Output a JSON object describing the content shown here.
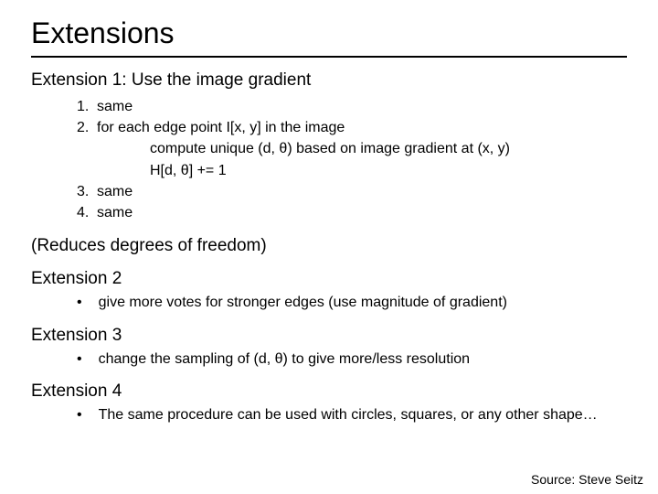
{
  "title": "Extensions",
  "ext1": {
    "heading": "Extension 1:  Use the image gradient",
    "items": {
      "n1": "1.",
      "t1": "same",
      "n2": "2.",
      "t2": "for each edge point I[x, y] in the image",
      "t2a": "compute unique (d, θ) based on image gradient at (x, y)",
      "t2b": "H[d, θ] += 1",
      "n3": "3.",
      "t3": "same",
      "n4": "4.",
      "t4": "same"
    }
  },
  "reduces": "(Reduces degrees of freedom)",
  "ext2": {
    "heading": "Extension 2",
    "bullet": "give more votes for stronger edges (use magnitude of gradient)"
  },
  "ext3": {
    "heading": "Extension 3",
    "bullet": "change the sampling of (d, θ) to give more/less resolution"
  },
  "ext4": {
    "heading": "Extension 4",
    "bullet": "The same procedure can be used with circles, squares, or any other shape…"
  },
  "source": "Source: Steve Seitz",
  "dot": "•"
}
